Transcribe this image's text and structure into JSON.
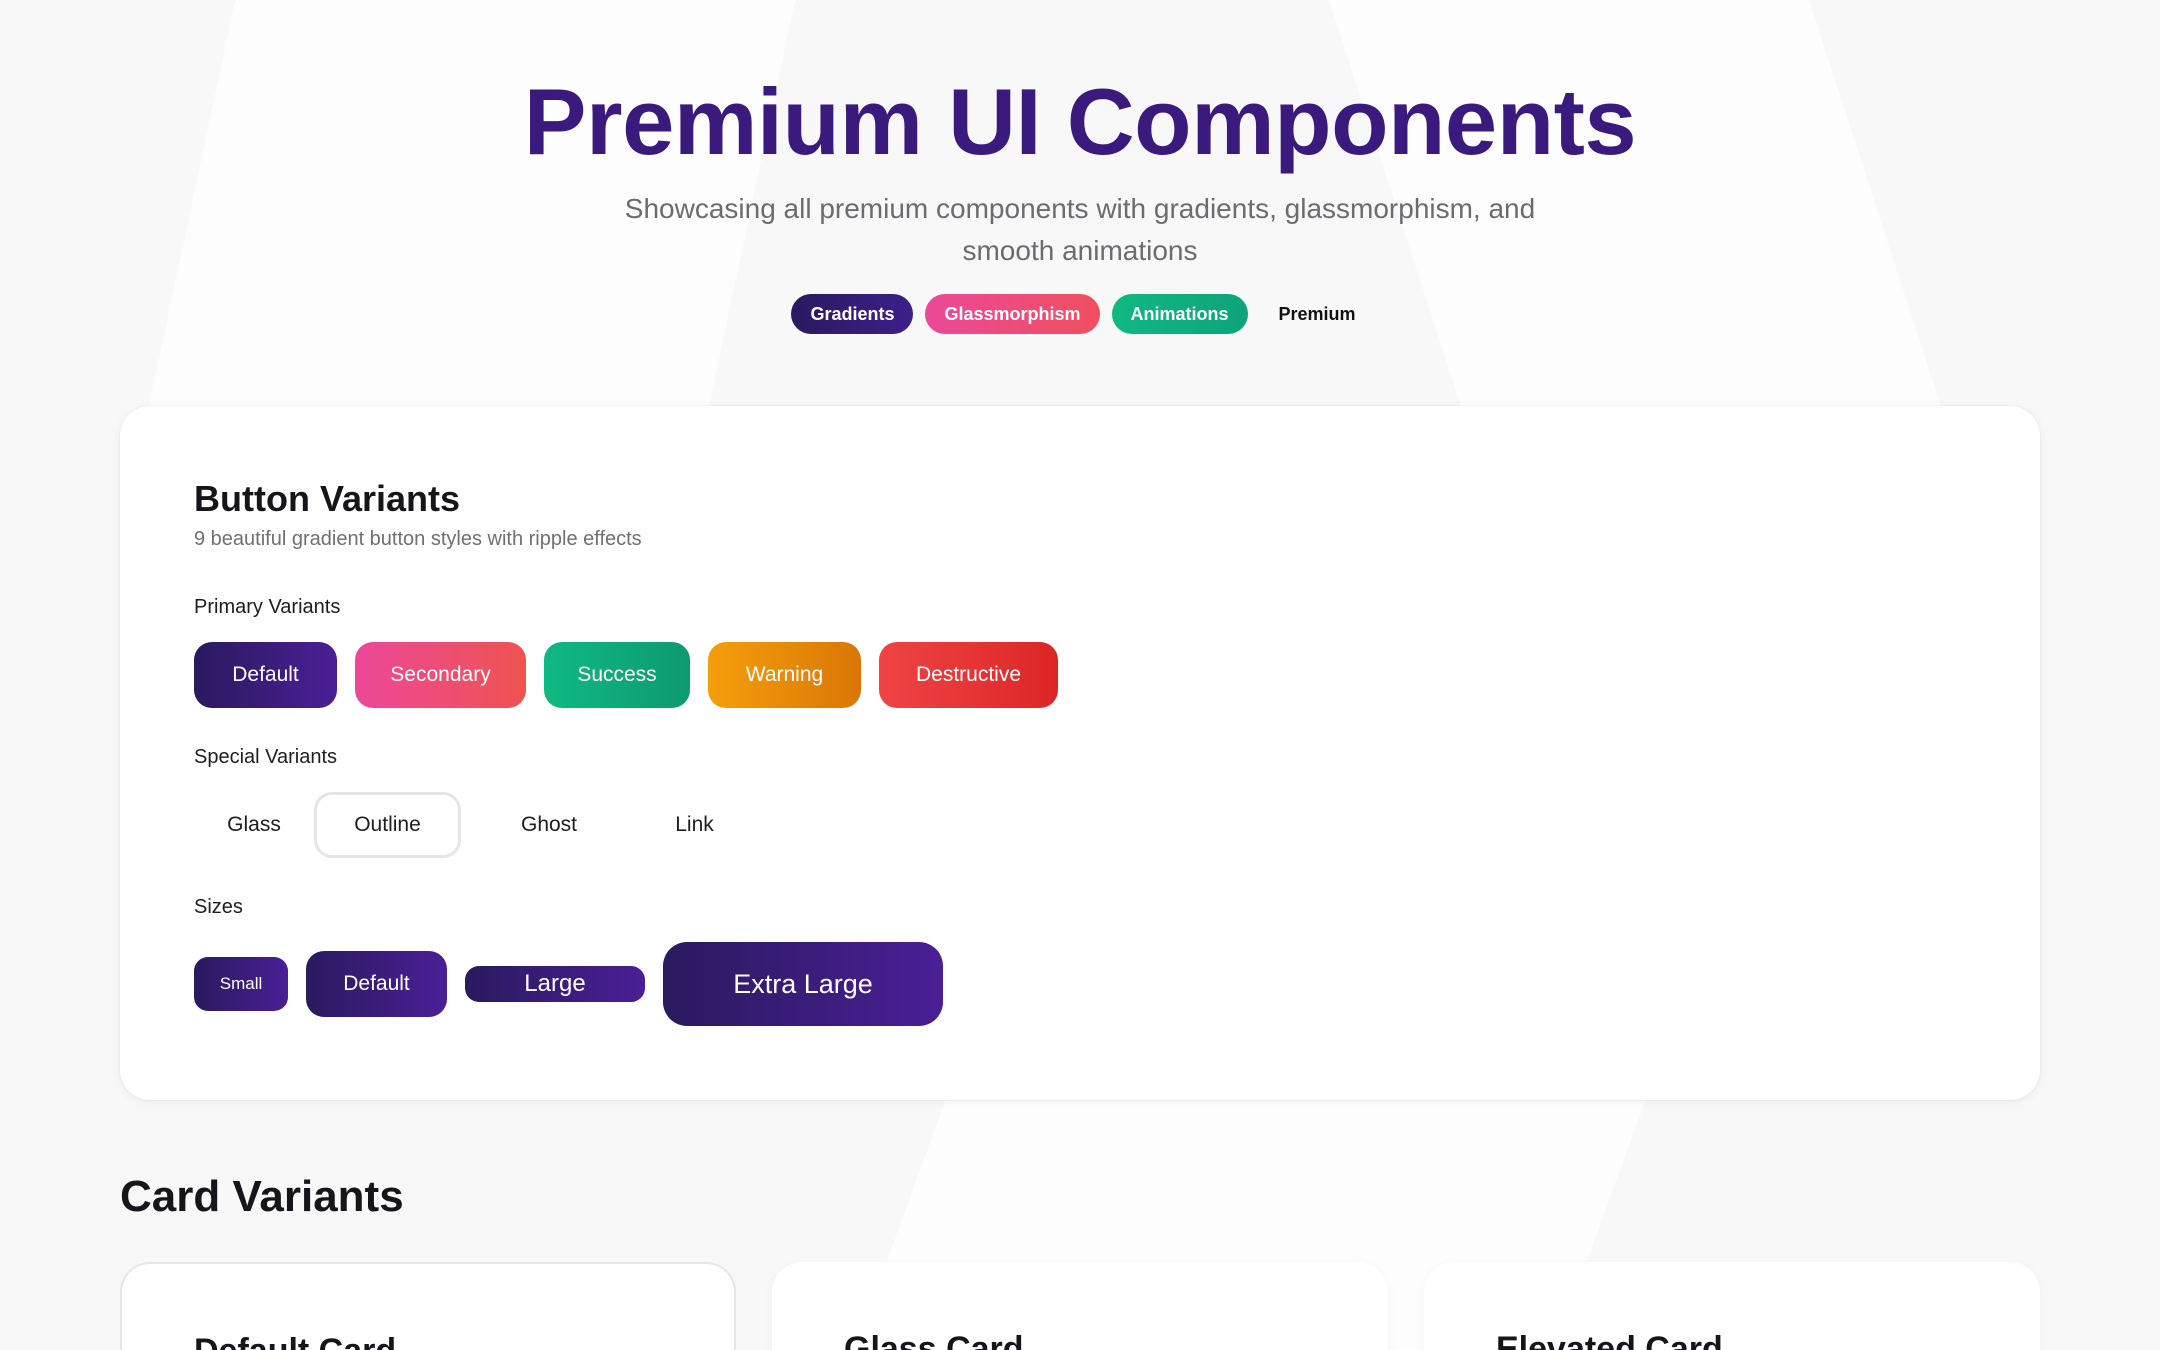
{
  "hero": {
    "title": "Premium UI Components",
    "subtitle": "Showcasing all premium components with gradients, glassmorphism, and smooth animations",
    "pills": [
      "Gradients",
      "Glassmorphism",
      "Animations",
      "Premium"
    ]
  },
  "buttons_section": {
    "title": "Button Variants",
    "subtitle": "9 beautiful gradient button styles with ripple effects",
    "primary_label": "Primary Variants",
    "primary": [
      "Default",
      "Secondary",
      "Success",
      "Warning",
      "Destructive"
    ],
    "special_label": "Special Variants",
    "special": [
      "Glass",
      "Outline",
      "Ghost",
      "Link"
    ],
    "sizes_label": "Sizes",
    "sizes": [
      "Small",
      "Default",
      "Large",
      "Extra Large"
    ]
  },
  "cards_section": {
    "title": "Card Variants",
    "cards": [
      "Default Card",
      "Glass Card",
      "Elevated Card"
    ]
  },
  "colors": {
    "brand": "#3b1a7e",
    "default_gradient_start": "#2a1a5e",
    "secondary": "#ec4899",
    "success": "#10b981",
    "warning": "#f59e0b",
    "destructive": "#ef4444"
  }
}
